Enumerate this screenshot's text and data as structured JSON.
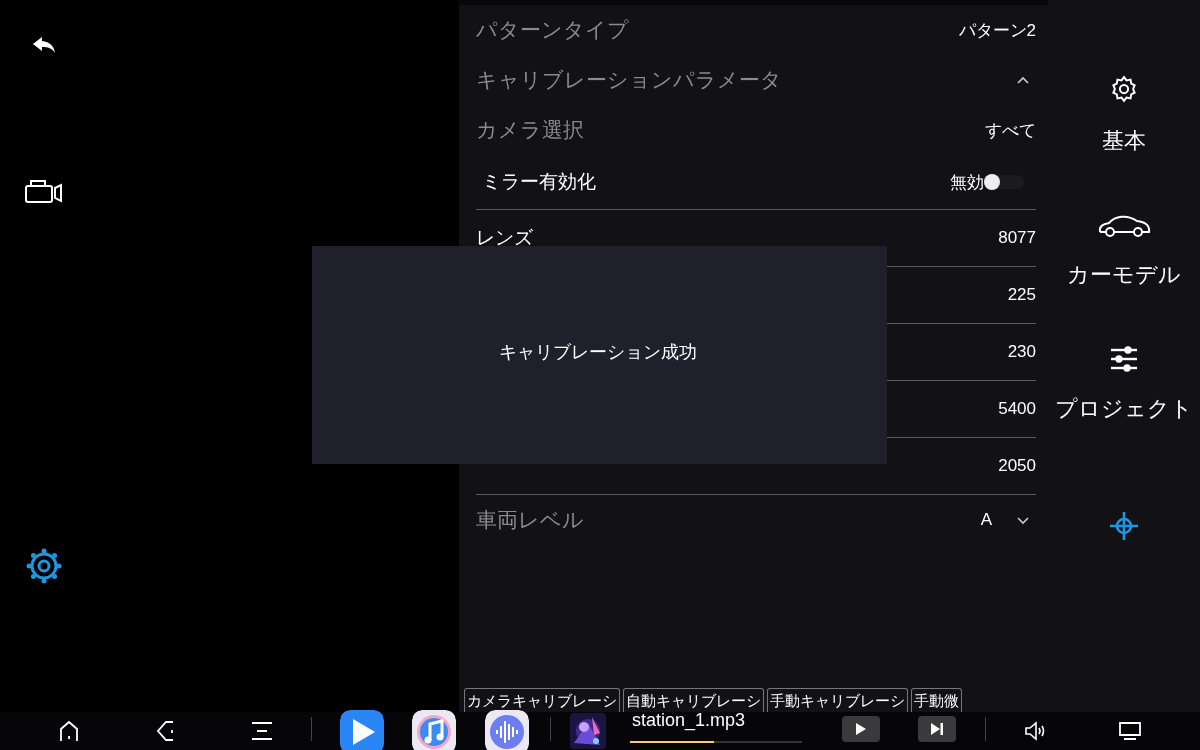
{
  "sidebar": {
    "items": [
      {
        "selected": false
      },
      {
        "selected": false
      },
      {
        "selected": true
      }
    ]
  },
  "settings": {
    "rows": [
      {
        "kind": "value",
        "label": "パターンタイプ",
        "value": "パターン2",
        "disabled": true
      },
      {
        "kind": "section",
        "label": "キャリブレーションパラメータ",
        "expanded": true,
        "disabled": true
      },
      {
        "kind": "value",
        "label": "カメラ選択",
        "value": "すべて",
        "disabled": true
      },
      {
        "kind": "toggle",
        "label": "ミラー有効化",
        "value": "無効",
        "on": false,
        "disabled": false
      },
      {
        "kind": "number",
        "label": "レンズ",
        "value": "8077",
        "disabled": false
      },
      {
        "kind": "number",
        "value": "225",
        "disabled": false
      },
      {
        "kind": "number",
        "value": "230",
        "disabled": false
      },
      {
        "kind": "number",
        "value": "5400",
        "disabled": false
      },
      {
        "kind": "number",
        "value": "2050",
        "disabled": false
      },
      {
        "kind": "dropdown",
        "label": "車両レベル",
        "value": "A",
        "expanded": false,
        "disabled": true
      }
    ],
    "buttons": [
      "カメラキャリブレーシ",
      "自動キャリブレーシ",
      "手動キャリブレーシ",
      "手動微"
    ]
  },
  "dialog": {
    "message": "キャリブレーション成功"
  },
  "nav": {
    "items": [
      {
        "label": "基本",
        "selected": false
      },
      {
        "label": "カーモデル",
        "selected": false
      },
      {
        "label": "プロジェクト",
        "selected": false
      },
      {
        "selected": true
      }
    ]
  },
  "taskbar": {
    "track": "station_1.mp3",
    "progress": {
      "level": 0.49
    }
  }
}
